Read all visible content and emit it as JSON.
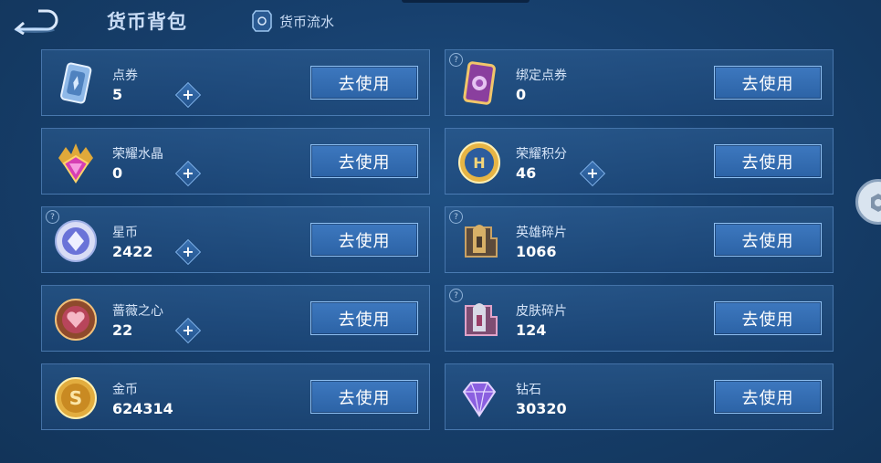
{
  "header": {
    "title": "货币背包",
    "flow_label": "货币流水"
  },
  "action_label": "去使用",
  "currencies": [
    {
      "name": "点券",
      "value": "5",
      "plus": true,
      "help": false,
      "icon": "ticket-icon"
    },
    {
      "name": "绑定点券",
      "value": "0",
      "plus": false,
      "help": true,
      "icon": "bound-ticket-icon"
    },
    {
      "name": "荣耀水晶",
      "value": "0",
      "plus": true,
      "help": false,
      "icon": "crystal-icon"
    },
    {
      "name": "荣耀积分",
      "value": "46",
      "plus": true,
      "help": false,
      "icon": "honor-points-icon"
    },
    {
      "name": "星币",
      "value": "2422",
      "plus": true,
      "help": true,
      "icon": "star-coin-icon"
    },
    {
      "name": "英雄碎片",
      "value": "1066",
      "plus": false,
      "help": true,
      "icon": "hero-fragment-icon"
    },
    {
      "name": "蔷薇之心",
      "value": "22",
      "plus": true,
      "help": false,
      "icon": "rose-heart-icon"
    },
    {
      "name": "皮肤碎片",
      "value": "124",
      "plus": false,
      "help": true,
      "icon": "skin-fragment-icon"
    },
    {
      "name": "金币",
      "value": "624314",
      "plus": false,
      "help": false,
      "icon": "gold-coin-icon"
    },
    {
      "name": "钻石",
      "value": "30320",
      "plus": false,
      "help": false,
      "icon": "diamond-icon"
    }
  ],
  "colors": {
    "accent": "#3d78bf",
    "background": "#17406e"
  }
}
